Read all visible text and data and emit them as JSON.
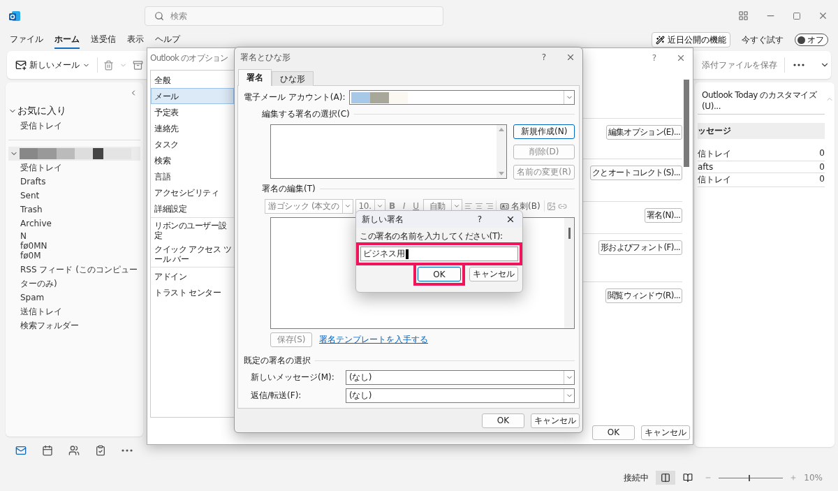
{
  "title_bar": {
    "search_placeholder": "検索"
  },
  "menu": [
    {
      "label": "ファイル",
      "selected": false
    },
    {
      "label": "ホーム",
      "selected": true
    },
    {
      "label": "送受信",
      "selected": false
    },
    {
      "label": "表示",
      "selected": false
    },
    {
      "label": "ヘルプ",
      "selected": false
    }
  ],
  "coming_soon": {
    "label": "近日公開の機能"
  },
  "try_now": {
    "label": "今すぐ試す",
    "toggle_label": "オフ",
    "on": false
  },
  "ribbon": {
    "new_mail": "新しいメール",
    "save_attachments": "添付ファイルを保存"
  },
  "sidebar": {
    "favorites": {
      "label": "お気に入り",
      "expanded": true,
      "folders": [
        "受信トレイ"
      ]
    },
    "account": {
      "expanded": true,
      "folders": [
        "受信トレイ",
        "Drafts",
        "Sent",
        "Trash",
        "Archive",
        "N\nfø0MN\nfø0M",
        "RSS フィード (このコンピューターのみ)",
        "Spam",
        "送信トレイ",
        "検索フォルダー"
      ]
    }
  },
  "nav": [
    {
      "kind": "mail",
      "selected": true
    },
    {
      "kind": "calendar",
      "selected": false
    },
    {
      "kind": "people",
      "selected": false
    },
    {
      "kind": "tasks",
      "selected": false
    },
    {
      "kind": "more",
      "selected": false
    }
  ],
  "reading_pane": {
    "customize": "Outlook Today のカスタマイズ(U)...",
    "header": "ッセージ",
    "rows": [
      {
        "name": "信トレイ",
        "count": "0"
      },
      {
        "name": "afts",
        "count": "0"
      },
      {
        "name": "信トレイ",
        "count": "0"
      }
    ]
  },
  "status_bar": {
    "status": "接続中",
    "views": [
      {
        "kind": "normal",
        "selected": true
      },
      {
        "kind": "reading",
        "selected": false
      }
    ],
    "zoom": {
      "level": 0.46,
      "label": "10%"
    }
  },
  "options_dialog": {
    "title": "Outlook のオプション",
    "help": "?",
    "nav_groups": [
      [
        {
          "label": "全般",
          "selected": false
        },
        {
          "label": "メール",
          "selected": true
        },
        {
          "label": "予定表",
          "selected": false
        },
        {
          "label": "連絡先",
          "selected": false
        },
        {
          "label": "タスク",
          "selected": false
        },
        {
          "label": "検索",
          "selected": false
        },
        {
          "label": "言語",
          "selected": false
        },
        {
          "label": "アクセシビリティ",
          "selected": false
        },
        {
          "label": "詳細設定",
          "selected": false
        }
      ],
      [
        {
          "label": "リボンのユーザー設定",
          "selected": false
        },
        {
          "label": "クイック アクセス ツール バー",
          "selected": false
        }
      ],
      [
        {
          "label": "アドイン",
          "selected": false
        },
        {
          "label": "トラスト センター",
          "selected": false
        }
      ]
    ],
    "content_buttons": [
      "編集オプション(E)...",
      "クとオートコレクト(S)...",
      "署名(N)...",
      "形およびフォント(F)...",
      "閲覧ウィンドウ(R)..."
    ],
    "buttons": [
      "OK",
      "キャンセル"
    ]
  },
  "signature_dialog": {
    "title": "署名とひな形",
    "help": "?",
    "tabs": [
      {
        "label": "署名",
        "selected": true
      },
      {
        "label": "ひな形",
        "selected": false
      }
    ],
    "account_label": "電子メール アカウント(A):",
    "select_label": "編集する署名の選択(C)",
    "side_buttons": [
      {
        "label": "新規作成(N)",
        "disabled": false
      },
      {
        "label": "削除(D)",
        "disabled": true
      },
      {
        "label": "名前の変更(R)",
        "disabled": true
      }
    ],
    "edit_label": "署名の編集(T)",
    "toolbar": {
      "disabled": true,
      "font": "游ゴシック (本文の",
      "size": "10.",
      "bold": "B",
      "italic": "I",
      "underline": "U",
      "font_color": "自動",
      "business_card": "名刺(B)"
    },
    "save": {
      "label": "保存(S)",
      "disabled": true
    },
    "template_link": "署名テンプレートを入手する",
    "defaults_label": "既定の署名の選択",
    "defaults": [
      {
        "label": "新しいメッセージ(M):",
        "value": "(なし)"
      },
      {
        "label": "返信/転送(F):",
        "value": "(なし)"
      }
    ],
    "buttons": [
      "OK",
      "キャンセル"
    ]
  },
  "new_signature_dialog": {
    "title": "新しい署名",
    "help": "?",
    "prompt": "この署名の名前を入力してください(T):",
    "value": "ビジネス用",
    "value_highlighted": true,
    "buttons": [
      {
        "label": "OK",
        "highlighted": true
      },
      {
        "label": "キャンセル",
        "highlighted": false
      }
    ]
  }
}
